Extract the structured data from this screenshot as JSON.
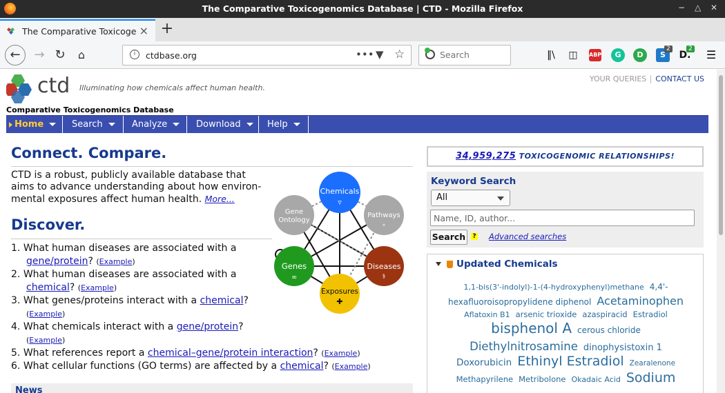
{
  "window": {
    "title": "The Comparative Toxicogenomics Database | CTD - Mozilla Firefox"
  },
  "tab": {
    "title": "The Comparative Toxicogenomics Database | CTD"
  },
  "address": {
    "url": "ctdbase.org",
    "search_placeholder": "Search"
  },
  "toolbar": {
    "badge_s": "2",
    "badge_d": "2"
  },
  "site": {
    "logo_text": "ctd",
    "tagline": "Illuminating how chemicals affect human health.",
    "name": "Comparative Toxicogenomics Database",
    "your_queries": "YOUR QUERIES",
    "contact_us": "CONTACT US"
  },
  "menu": [
    "Home",
    "Search",
    "Analyze",
    "Download",
    "Help"
  ],
  "connect": {
    "heading": "Connect. Compare.",
    "text": "CTD is a robust, publicly available database that aims to advance understanding about how environ-mental exposures affect human health.",
    "more": "More..."
  },
  "discover": {
    "heading": "Discover.",
    "questions": [
      {
        "num": "1.",
        "pre": "What human diseases are associated with a ",
        "link": "gene/protein",
        "post": "?",
        "example": "Example"
      },
      {
        "num": "2.",
        "pre": "What human diseases are associated with a ",
        "link": "chemical",
        "post": "?",
        "example": "Example"
      },
      {
        "num": "3.",
        "pre": "What genes/proteins interact with a ",
        "link": "chemical",
        "post": "?",
        "example": "Example"
      },
      {
        "num": "4.",
        "pre": "What chemicals interact with a ",
        "link": "gene/protein",
        "post": "?",
        "example": "Example"
      },
      {
        "num": "5.",
        "pre": "What references report a ",
        "link": "chemical–gene/protein interaction",
        "post": "?",
        "example": "Example"
      },
      {
        "num": "6.",
        "pre": "What cellular functions (GO terms) are affected by a ",
        "link": "chemical",
        "post": "?",
        "example": "Example"
      }
    ]
  },
  "news_label": "News",
  "diagram": {
    "nodes": {
      "chemicals": {
        "label": "Chemicals",
        "color": "#1a6fff"
      },
      "pathways": {
        "label": "Pathways",
        "color": "#a8a8a8"
      },
      "diseases": {
        "label": "Diseases",
        "color": "#9c3412"
      },
      "exposures": {
        "label": "Exposures",
        "color": "#f2c200"
      },
      "genes": {
        "label": "Genes",
        "color": "#1f9a1f"
      },
      "go": {
        "label_line1": "Gene",
        "label_line2": "Ontology",
        "color": "#a8a8a8"
      }
    }
  },
  "stats": {
    "count": "34,959,275",
    "label": "TOXICOGENOMIC RELATIONSHIPS!"
  },
  "keyword": {
    "title": "Keyword Search",
    "select_value": "All",
    "input_placeholder": "Name, ID, author...",
    "search_button": "Search",
    "help": "?",
    "advanced": "Advanced searches"
  },
  "updated": {
    "title": "Updated Chemicals",
    "rows": [
      [
        {
          "t": "1,1-bis(3'-indolyl)-1-(4-hydroxyphenyl)methane",
          "s": 11
        },
        {
          "t": "4,4'-",
          "s": 12
        }
      ],
      [
        {
          "t": "hexafluoroisopropylidene diphenol",
          "s": 12
        },
        {
          "t": "Acetaminophen",
          "s": 16
        }
      ],
      [
        {
          "t": "Aflatoxin B1",
          "s": 11
        },
        {
          "t": "arsenic trioxide",
          "s": 11.5
        },
        {
          "t": "azaspiracid",
          "s": 11.5
        },
        {
          "t": "Estradiol",
          "s": 11.5
        }
      ],
      [
        {
          "t": "bisphenol A",
          "s": 20
        },
        {
          "t": "cerous chloride",
          "s": 12
        }
      ],
      [
        {
          "t": "Diethylnitrosamine",
          "s": 16.5
        },
        {
          "t": "dinophysistoxin 1",
          "s": 13
        }
      ],
      [
        {
          "t": "Doxorubicin",
          "s": 13.5
        },
        {
          "t": "Ethinyl Estradiol",
          "s": 19
        },
        {
          "t": "Zearalenone",
          "s": 10.5
        }
      ],
      [
        {
          "t": "Methapyrilene",
          "s": 11.5
        },
        {
          "t": "Metribolone",
          "s": 11.5
        },
        {
          "t": "Okadaic Acid",
          "s": 11
        },
        {
          "t": "Sodium",
          "s": 19
        }
      ]
    ]
  }
}
